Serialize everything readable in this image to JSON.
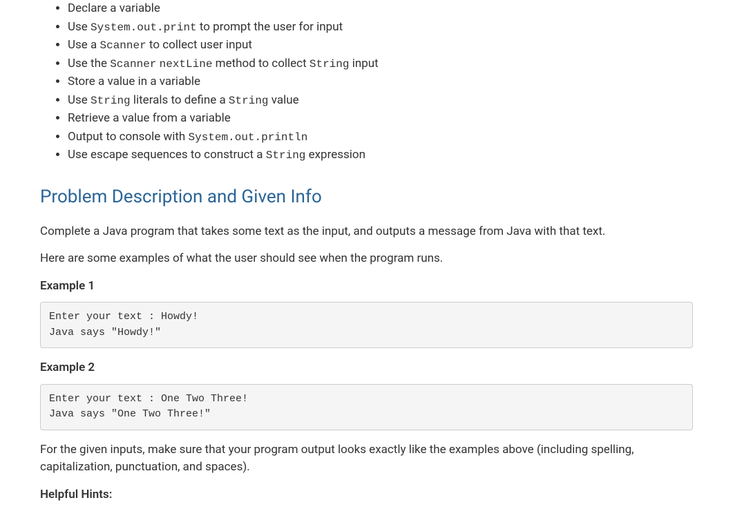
{
  "bullets": {
    "b0": "Declare a variable",
    "b1a": "Use ",
    "b1code": "System.out.print",
    "b1b": " to prompt the user for input",
    "b2a": "Use a ",
    "b2code": "Scanner",
    "b2b": " to collect user input",
    "b3a": "Use the ",
    "b3code1": "Scanner",
    "b3sp": " ",
    "b3code2": "nextLine",
    "b3b": " method to collect ",
    "b3code3": "String",
    "b3c": " input",
    "b4": "Store a value in a variable",
    "b5a": "Use ",
    "b5code1": "String",
    "b5b": " literals to define a ",
    "b5code2": "String",
    "b5c": " value",
    "b6": "Retrieve a value from a variable",
    "b7a": "Output to console with ",
    "b7code": "System.out.println",
    "b8a": "Use escape sequences to construct a ",
    "b8code": "String",
    "b8b": " expression"
  },
  "heading": "Problem Description and Given Info",
  "para1": "Complete a Java program that takes some text as the input, and outputs a message from Java with that text.",
  "para2": "Here are some examples of what the user should see when the program runs.",
  "example1_label": "Example 1",
  "example1_code": "Enter your text : Howdy!\nJava says \"Howdy!\"",
  "example2_label": "Example 2",
  "example2_code": "Enter your text : One Two Three!\nJava says \"One Two Three!\"",
  "para3": "For the given inputs, make sure that your program output looks exactly like the examples above (including spelling, capitalization, punctuation, and spaces).",
  "hints_label": "Helpful Hints:"
}
